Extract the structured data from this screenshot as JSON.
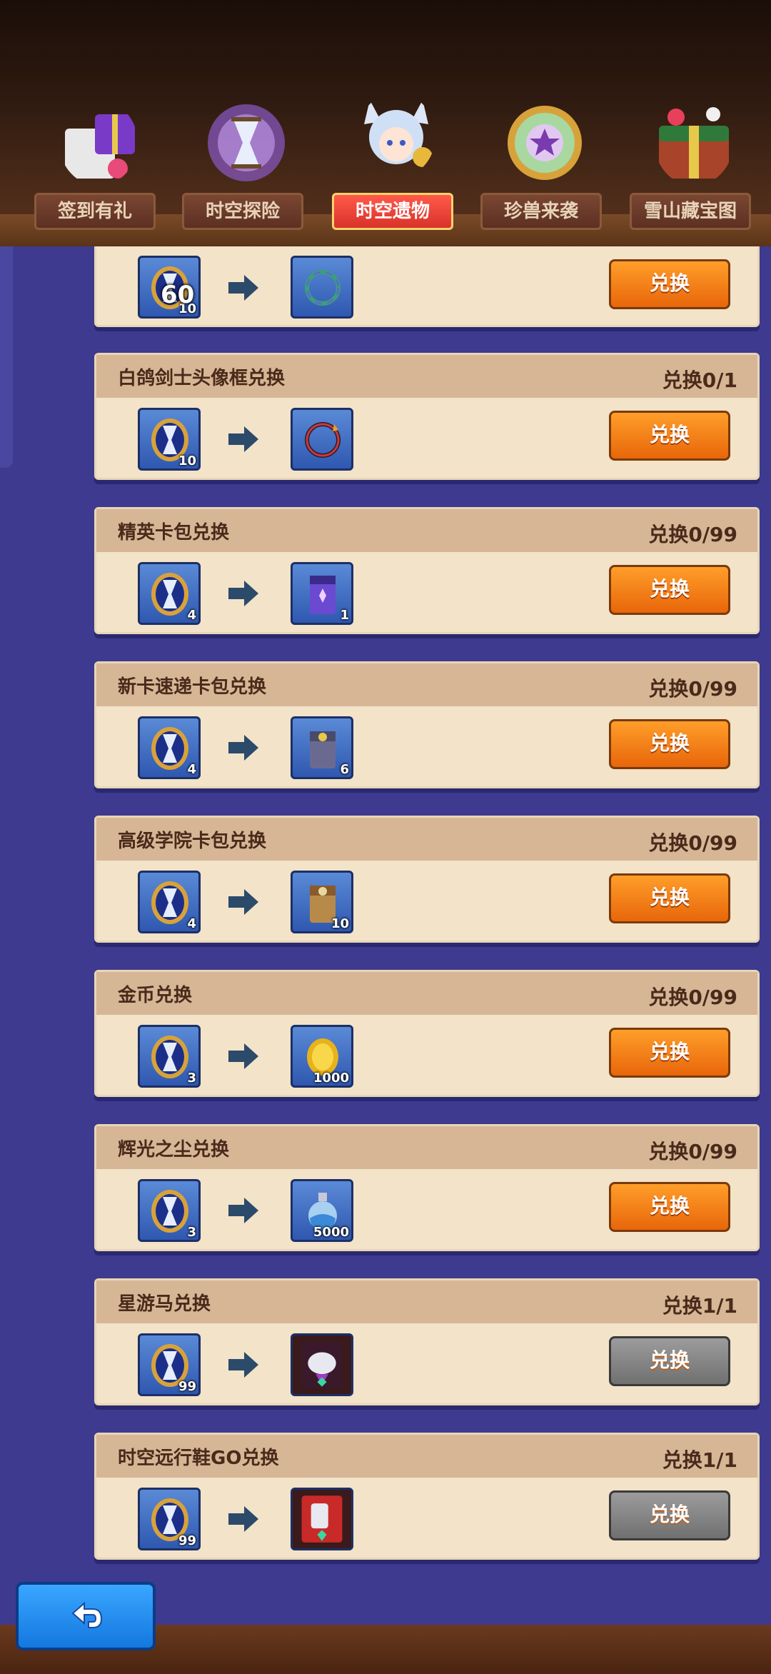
{
  "tabs": [
    {
      "label": "签到有礼",
      "icon": "gift-calendar-icon",
      "active": false
    },
    {
      "label": "时空探险",
      "icon": "hourglass-orb-icon",
      "active": false
    },
    {
      "label": "时空遗物",
      "icon": "fox-girl-icon",
      "active": true
    },
    {
      "label": "珍兽来袭",
      "icon": "star-medallion-icon",
      "active": false
    },
    {
      "label": "雪山藏宝图",
      "icon": "treasure-chest-icon",
      "active": false
    }
  ],
  "cost_icon": "hourglass-icon",
  "arrow_icon": "right-arrow-icon",
  "button_label": "兑换",
  "partial_card": {
    "cost_qty": "10",
    "reward_icon": "avatar-frame-icon",
    "floating_count": "60"
  },
  "exchanges": [
    {
      "title": "白鸽剑士头像框兑换",
      "limit": "兑换0/1",
      "cost_qty": "10",
      "reward_icon": "avatar-frame-icon",
      "reward_qty": "",
      "enabled": true
    },
    {
      "title": "精英卡包兑换",
      "limit": "兑换0/99",
      "cost_qty": "4",
      "reward_icon": "card-pack-purple-icon",
      "reward_qty": "1",
      "enabled": true
    },
    {
      "title": "新卡速递卡包兑换",
      "limit": "兑换0/99",
      "cost_qty": "4",
      "reward_icon": "card-pack-grey-icon",
      "reward_qty": "6",
      "enabled": true
    },
    {
      "title": "高级学院卡包兑换",
      "limit": "兑换0/99",
      "cost_qty": "4",
      "reward_icon": "card-pack-brown-icon",
      "reward_qty": "10",
      "enabled": true
    },
    {
      "title": "金币兑换",
      "limit": "兑换0/99",
      "cost_qty": "3",
      "reward_icon": "gold-coin-icon",
      "reward_qty": "1000",
      "enabled": true
    },
    {
      "title": "辉光之尘兑换",
      "limit": "兑换0/99",
      "cost_qty": "3",
      "reward_icon": "dust-bottle-icon",
      "reward_qty": "5000",
      "enabled": true
    },
    {
      "title": "星游马兑换",
      "limit": "兑换1/1",
      "cost_qty": "99",
      "reward_icon": "star-horse-mount-icon",
      "reward_qty": "",
      "enabled": false
    },
    {
      "title": "时空远行鞋GO兑换",
      "limit": "兑换1/1",
      "cost_qty": "99",
      "reward_icon": "travel-shoes-icon",
      "reward_qty": "",
      "enabled": false
    }
  ],
  "back_icon": "back-arrow-icon"
}
